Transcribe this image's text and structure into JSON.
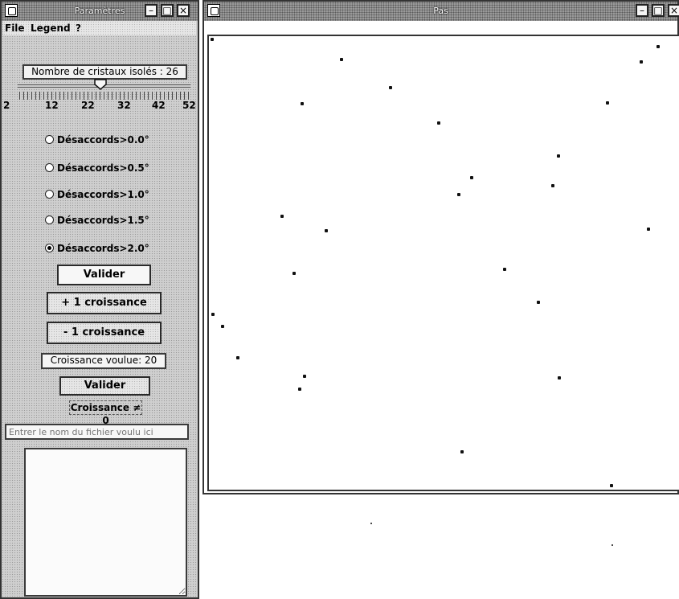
{
  "left_window": {
    "title": "Paramètres",
    "menu": [
      "File",
      "Legend",
      "?"
    ],
    "isolated_field": "Nombre de cristaux isolés : 26",
    "slider": {
      "value": 26,
      "min": 2,
      "max": 52,
      "tick_labels": [
        "2",
        "12",
        "22",
        "32",
        "42",
        "52"
      ]
    },
    "radios": [
      {
        "label": "Désaccords>0.0°",
        "selected": false
      },
      {
        "label": "Désaccords>0.5°",
        "selected": false
      },
      {
        "label": "Désaccords>1.0°",
        "selected": false
      },
      {
        "label": "Désaccords>1.5°",
        "selected": false
      },
      {
        "label": "Désaccords>2.0°",
        "selected": true
      }
    ],
    "validate_label": "Valider",
    "grow_plus_label": "+ 1 croissance",
    "grow_minus_label": "- 1 croissance",
    "wanted_growth": "Croissance voulue: 20",
    "validate2_label": "Valider",
    "growth_status": "Croissance ≠ 0",
    "filename_placeholder": "Entrer le nom du fichier voulu ici",
    "notes_value": ""
  },
  "right_window": {
    "title": "Pas",
    "dots_count": 30
  },
  "colors": {
    "titlebar": "#9a9a9a",
    "panel": "#cfcfcf",
    "canvas": "#ffffff",
    "border": "#333333"
  },
  "icons": [
    "app-icon",
    "minimize-icon",
    "maximize-icon",
    "close-icon"
  ]
}
